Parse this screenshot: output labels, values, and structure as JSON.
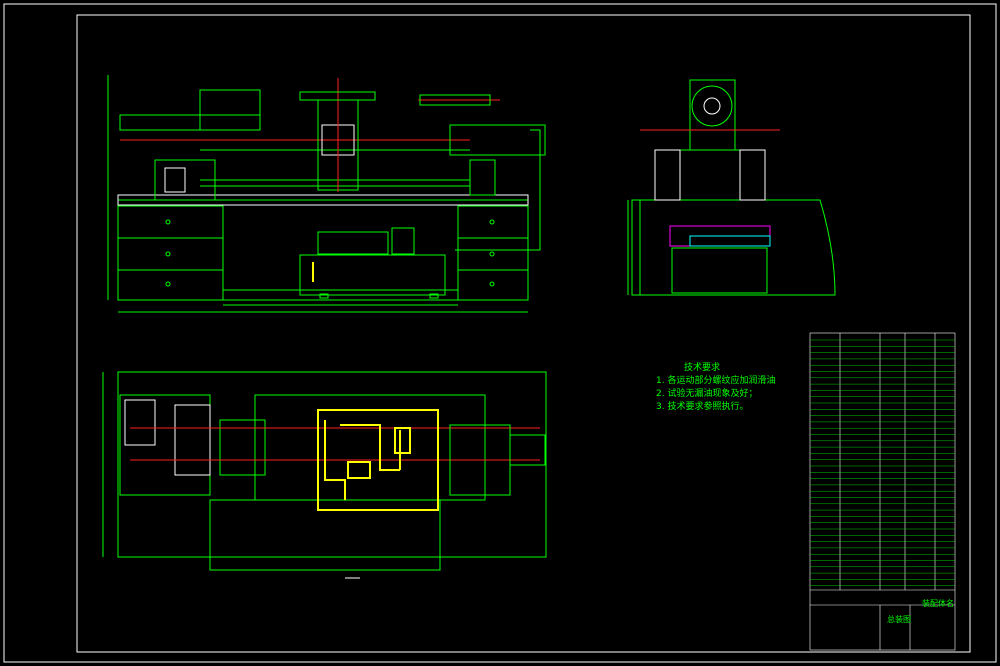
{
  "canvas": {
    "background": "#000000",
    "line_green": "#00ff00",
    "line_white": "#ffffff",
    "line_red": "#ff2020",
    "line_yellow": "#ffff00",
    "line_magenta": "#ff00ff",
    "line_cyan": "#00ffff"
  },
  "technical_notes": {
    "heading": "技术要求",
    "items": [
      "1. 各运动部分螺纹应加润滑油",
      "2. 试验无漏油现象及好；",
      "3. 技术要求参照执行。"
    ]
  },
  "title_block": {
    "title": "总装图",
    "subtitle": "装配体名"
  },
  "views": [
    {
      "name": "front-view"
    },
    {
      "name": "side-view"
    },
    {
      "name": "top-view"
    }
  ]
}
